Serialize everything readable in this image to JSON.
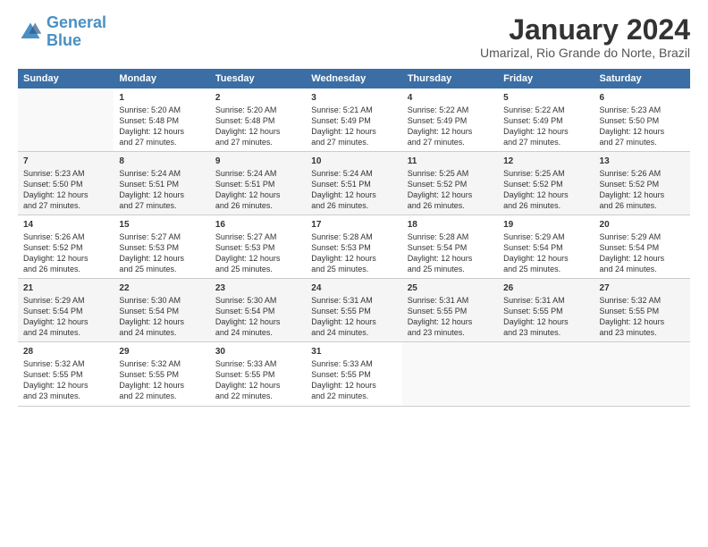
{
  "logo": {
    "line1": "General",
    "line2": "Blue"
  },
  "title": "January 2024",
  "subtitle": "Umarizal, Rio Grande do Norte, Brazil",
  "header_days": [
    "Sunday",
    "Monday",
    "Tuesday",
    "Wednesday",
    "Thursday",
    "Friday",
    "Saturday"
  ],
  "weeks": [
    [
      {
        "day": "",
        "info": ""
      },
      {
        "day": "1",
        "info": "Sunrise: 5:20 AM\nSunset: 5:48 PM\nDaylight: 12 hours\nand 27 minutes."
      },
      {
        "day": "2",
        "info": "Sunrise: 5:20 AM\nSunset: 5:48 PM\nDaylight: 12 hours\nand 27 minutes."
      },
      {
        "day": "3",
        "info": "Sunrise: 5:21 AM\nSunset: 5:49 PM\nDaylight: 12 hours\nand 27 minutes."
      },
      {
        "day": "4",
        "info": "Sunrise: 5:22 AM\nSunset: 5:49 PM\nDaylight: 12 hours\nand 27 minutes."
      },
      {
        "day": "5",
        "info": "Sunrise: 5:22 AM\nSunset: 5:49 PM\nDaylight: 12 hours\nand 27 minutes."
      },
      {
        "day": "6",
        "info": "Sunrise: 5:23 AM\nSunset: 5:50 PM\nDaylight: 12 hours\nand 27 minutes."
      }
    ],
    [
      {
        "day": "7",
        "info": "Sunrise: 5:23 AM\nSunset: 5:50 PM\nDaylight: 12 hours\nand 27 minutes."
      },
      {
        "day": "8",
        "info": "Sunrise: 5:24 AM\nSunset: 5:51 PM\nDaylight: 12 hours\nand 27 minutes."
      },
      {
        "day": "9",
        "info": "Sunrise: 5:24 AM\nSunset: 5:51 PM\nDaylight: 12 hours\nand 26 minutes."
      },
      {
        "day": "10",
        "info": "Sunrise: 5:24 AM\nSunset: 5:51 PM\nDaylight: 12 hours\nand 26 minutes."
      },
      {
        "day": "11",
        "info": "Sunrise: 5:25 AM\nSunset: 5:52 PM\nDaylight: 12 hours\nand 26 minutes."
      },
      {
        "day": "12",
        "info": "Sunrise: 5:25 AM\nSunset: 5:52 PM\nDaylight: 12 hours\nand 26 minutes."
      },
      {
        "day": "13",
        "info": "Sunrise: 5:26 AM\nSunset: 5:52 PM\nDaylight: 12 hours\nand 26 minutes."
      }
    ],
    [
      {
        "day": "14",
        "info": "Sunrise: 5:26 AM\nSunset: 5:52 PM\nDaylight: 12 hours\nand 26 minutes."
      },
      {
        "day": "15",
        "info": "Sunrise: 5:27 AM\nSunset: 5:53 PM\nDaylight: 12 hours\nand 25 minutes."
      },
      {
        "day": "16",
        "info": "Sunrise: 5:27 AM\nSunset: 5:53 PM\nDaylight: 12 hours\nand 25 minutes."
      },
      {
        "day": "17",
        "info": "Sunrise: 5:28 AM\nSunset: 5:53 PM\nDaylight: 12 hours\nand 25 minutes."
      },
      {
        "day": "18",
        "info": "Sunrise: 5:28 AM\nSunset: 5:54 PM\nDaylight: 12 hours\nand 25 minutes."
      },
      {
        "day": "19",
        "info": "Sunrise: 5:29 AM\nSunset: 5:54 PM\nDaylight: 12 hours\nand 25 minutes."
      },
      {
        "day": "20",
        "info": "Sunrise: 5:29 AM\nSunset: 5:54 PM\nDaylight: 12 hours\nand 24 minutes."
      }
    ],
    [
      {
        "day": "21",
        "info": "Sunrise: 5:29 AM\nSunset: 5:54 PM\nDaylight: 12 hours\nand 24 minutes."
      },
      {
        "day": "22",
        "info": "Sunrise: 5:30 AM\nSunset: 5:54 PM\nDaylight: 12 hours\nand 24 minutes."
      },
      {
        "day": "23",
        "info": "Sunrise: 5:30 AM\nSunset: 5:54 PM\nDaylight: 12 hours\nand 24 minutes."
      },
      {
        "day": "24",
        "info": "Sunrise: 5:31 AM\nSunset: 5:55 PM\nDaylight: 12 hours\nand 24 minutes."
      },
      {
        "day": "25",
        "info": "Sunrise: 5:31 AM\nSunset: 5:55 PM\nDaylight: 12 hours\nand 23 minutes."
      },
      {
        "day": "26",
        "info": "Sunrise: 5:31 AM\nSunset: 5:55 PM\nDaylight: 12 hours\nand 23 minutes."
      },
      {
        "day": "27",
        "info": "Sunrise: 5:32 AM\nSunset: 5:55 PM\nDaylight: 12 hours\nand 23 minutes."
      }
    ],
    [
      {
        "day": "28",
        "info": "Sunrise: 5:32 AM\nSunset: 5:55 PM\nDaylight: 12 hours\nand 23 minutes."
      },
      {
        "day": "29",
        "info": "Sunrise: 5:32 AM\nSunset: 5:55 PM\nDaylight: 12 hours\nand 22 minutes."
      },
      {
        "day": "30",
        "info": "Sunrise: 5:33 AM\nSunset: 5:55 PM\nDaylight: 12 hours\nand 22 minutes."
      },
      {
        "day": "31",
        "info": "Sunrise: 5:33 AM\nSunset: 5:55 PM\nDaylight: 12 hours\nand 22 minutes."
      },
      {
        "day": "",
        "info": ""
      },
      {
        "day": "",
        "info": ""
      },
      {
        "day": "",
        "info": ""
      }
    ]
  ]
}
